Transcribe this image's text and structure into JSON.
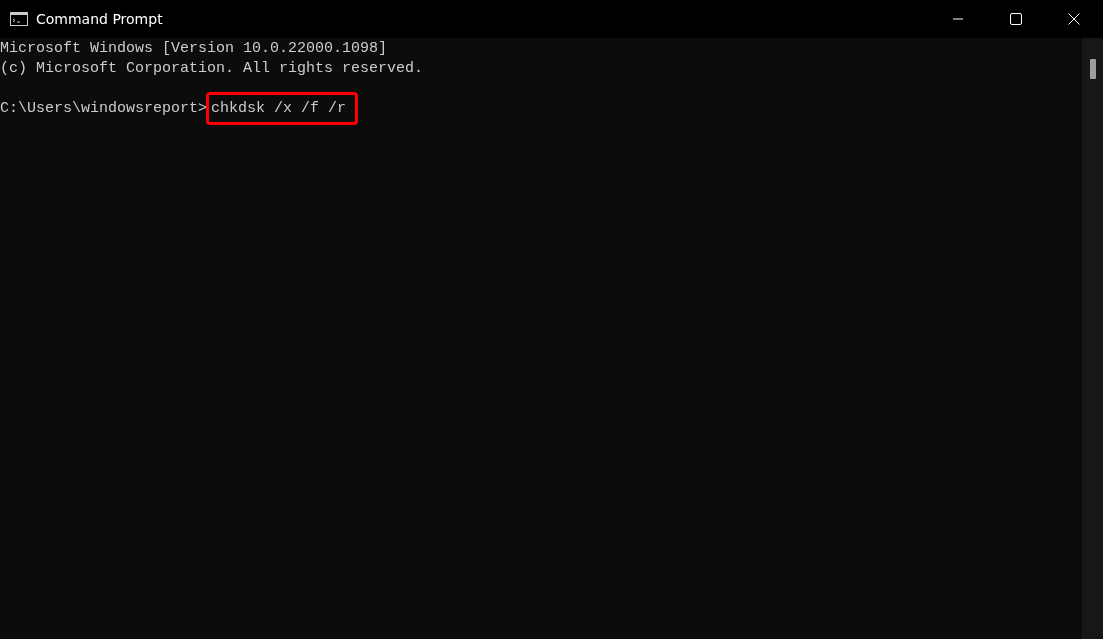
{
  "window": {
    "title": "Command Prompt"
  },
  "console": {
    "lines": [
      "Microsoft Windows [Version 10.0.22000.1098]",
      "(c) Microsoft Corporation. All rights reserved."
    ],
    "prompt": {
      "path": "C:\\Users\\windowsreport>",
      "command": "chkdsk /x /f /r",
      "highlighted": true
    }
  }
}
